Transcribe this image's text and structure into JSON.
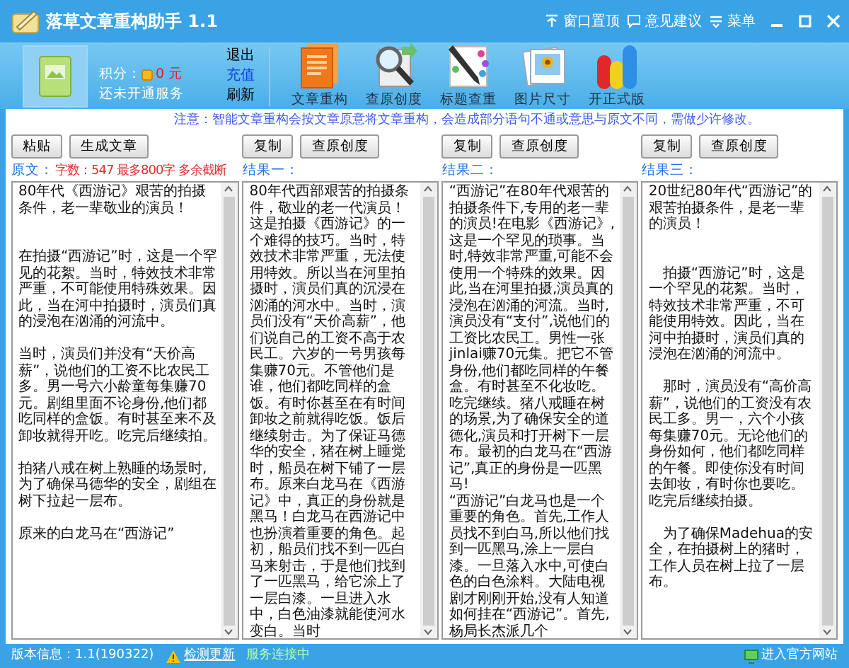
{
  "window": {
    "title": "落草文章重构助手 1.1",
    "actions": [
      {
        "label": "窗口置顶",
        "kind": "pin"
      },
      {
        "label": "意见建议",
        "kind": "feedback"
      },
      {
        "label": "菜单",
        "kind": "menu"
      }
    ]
  },
  "account": {
    "points_label": "积分：",
    "points": "0 元",
    "service": "还未开通服务",
    "links": [
      {
        "label": "退出",
        "color": "#000000"
      },
      {
        "label": "充值",
        "color": "#1040e0"
      },
      {
        "label": "刷新",
        "color": "#000000"
      }
    ]
  },
  "tools": [
    {
      "label": "文章重构",
      "kind": "document"
    },
    {
      "label": "查原创度",
      "kind": "magnifier"
    },
    {
      "label": "标题查重",
      "kind": "pen"
    },
    {
      "label": "图片尺寸",
      "kind": "photo"
    },
    {
      "label": "开正式版",
      "kind": "bars"
    }
  ],
  "notice": "注意：智能文章重构会按文章原意将文章重构，会造成部分语句不通或意思与原文不同，需做少许修改。",
  "source": {
    "buttons": [
      "粘贴",
      "生成文章"
    ],
    "label": "原文：",
    "count": "字数：547 最多800字 多余截断",
    "paragraphs": [
      {
        "kind": "lead",
        "text": "80年代《西游记》艰苦的拍摄条件，老一辈敬业的演员！"
      },
      {
        "kind": "body",
        "text": "在拍摄“西游记”时，这是一个罕见的花絮。当时，特效技术非常严重，不可能使用特殊效果。因此，当在河中拍摄时，演员们真的浸泡在汹涌的河流中。"
      },
      {
        "kind": "body",
        "text": "当时，演员们并没有“天价高薪”，说他们的工资不比农民工多。男一号六小龄童每集赚70元。剧组里面不论身份,他们都吃同样的盒饭。有时甚至来不及卸妆就得开吃。吃完后继续拍。"
      },
      {
        "kind": "body",
        "text": "拍猪八戒在树上熟睡的场景时,为了确保马德华的安全，剧组在树下拉起一层布。"
      },
      {
        "kind": "body",
        "text": "原来的白龙马在“西游记”"
      }
    ]
  },
  "results": [
    {
      "buttons": [
        "复制",
        "查原创度"
      ],
      "label": "结果一：",
      "paragraphs": [
        {
          "kind": "run",
          "text": "80年代西部艰苦的拍摄条件，敬业的老一代演员！这是拍摄《西游记》的一个难得的技巧。当时，特效技术非常严重，无法使用特效。所以当在河里拍摄时，演员们真的沉浸在汹涌的河水中。当时，演员们没有“天价高薪”，他们说自己的工资不高于农民工。六岁的一号男孩每集赚70元。不管他们是谁，他们都吃同样的盒饭。有时你甚至在有时间卸妆之前就得吃饭。饭后继续射击。为了保证马德华的安全，猪在树上睡觉时，船员在树下铺了一层布。原来白龙马在《西游记》中，真正的身份就是黑马！白龙马在西游记中也扮演着重要的角色。起初，船员们找不到一匹白马来射击，于是他们找到了一匹黑马，给它涂上了一层白漆。一旦进入水中，白色油漆就能使河水变白。当时"
        }
      ]
    },
    {
      "buttons": [
        "复制",
        "查原创度"
      ],
      "label": "结果二：",
      "paragraphs": [
        {
          "kind": "run",
          "text": "“西游记”在80年代艰苦的拍摄条件下,专用的老一辈的演员!在电影《西游记》,这是一个罕见的琐事。当时,特效非常严重,可能不会使用一个特殊的效果。因此,当在河里拍摄,演员真的浸泡在汹涌的河流。当时,演员没有“支付”,说他们的工资比农民工。男性一张jinlai赚70元集。把它不管身份,他们都吃同样的午餐盒。有时甚至不化妆吃。吃完继续。猪八戒睡在树的场景,为了确保安全的道德化,演员和打开树下一层布。最初的白龙马在“西游记”,真正的身份是一匹黑马!"
        },
        {
          "kind": "run",
          "text": "“西游记”白龙马也是一个重要的角色。首先,工作人员找不到白马,所以他们找到一匹黑马,涂上一层白漆。一旦落入水中,可使白色的白色涂料。大陆电视剧才刚刚开始,没有人知道如何挂在“西游记”。首先,杨局长杰派几个"
        }
      ]
    },
    {
      "buttons": [
        "复制",
        "查原创度"
      ],
      "label": "结果三：",
      "paragraphs": [
        {
          "kind": "lead",
          "text": "20世纪80年代“西游记”的艰苦拍摄条件，是老一辈的演员！"
        },
        {
          "kind": "body",
          "text": "　拍摄“西游记”时，这是一个罕见的花絮。当时，特效技术非常严重，不可能使用特效。因此，当在河中拍摄时，演员们真的浸泡在汹涌的河流中。"
        },
        {
          "kind": "body",
          "text": "　那时，演员没有“高价高薪”，说他们的工资没有农民工多。男一，六个小孩每集赚70元。无论他们的身份如何，他们都吃同样的午餐。即使你没有时间去卸妆，有时你也要吃。吃完后继续拍摄。"
        },
        {
          "kind": "body",
          "text": "　为了确保Madehua的安全，在拍摄树上的猪时，工作人员在树上拉了一层布。"
        }
      ]
    }
  ],
  "status_bar": {
    "version": "版本信息：1.1(190322)",
    "update_link": "检测更新",
    "connection": "服务连接中",
    "website": "进入官方网站"
  }
}
